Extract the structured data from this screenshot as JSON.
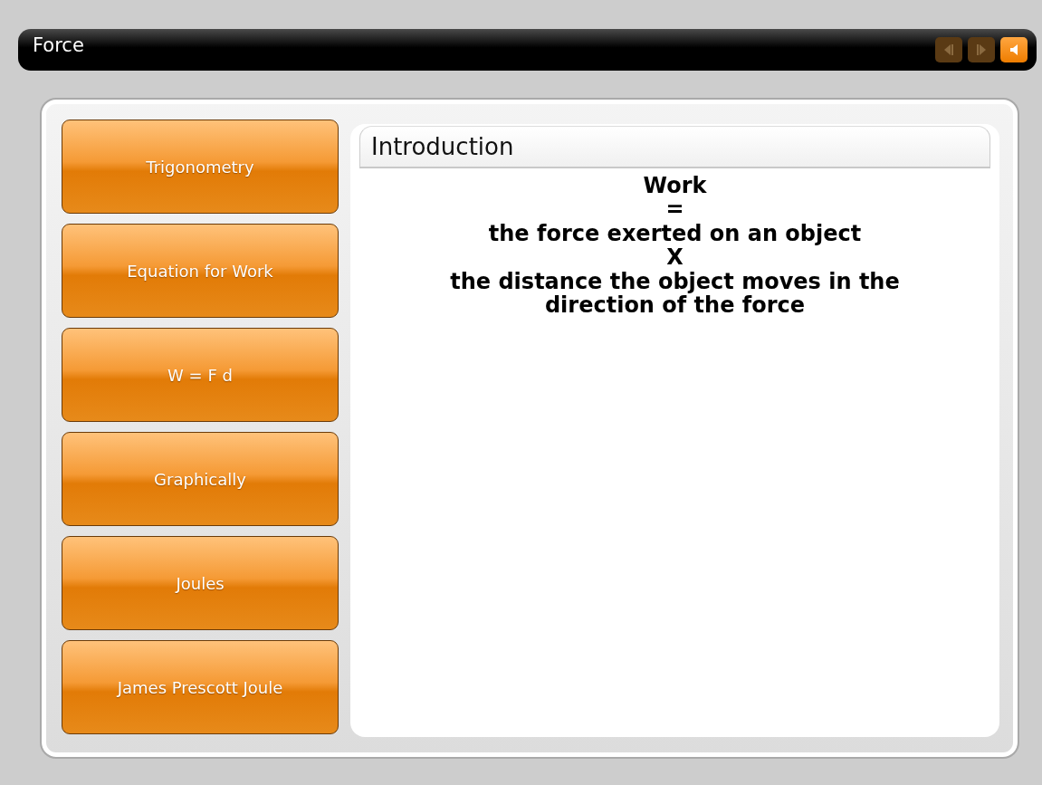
{
  "window": {
    "title": "Force"
  },
  "toolbar": [
    {
      "kind": "previous",
      "disabled": true
    },
    {
      "kind": "next",
      "disabled": true
    },
    {
      "kind": "sound",
      "disabled": false
    }
  ],
  "menu": [
    {
      "label": "Trigonometry"
    },
    {
      "label": "Equation for Work"
    },
    {
      "label": "W = F d"
    },
    {
      "label": "Graphically"
    },
    {
      "label": "Joules"
    },
    {
      "label": "James Prescott Joule"
    }
  ],
  "content": {
    "heading": "Introduction",
    "lines": [
      "Work",
      "=",
      "the force exerted on an object",
      "X",
      "the distance the object moves in the direction of the force"
    ]
  }
}
